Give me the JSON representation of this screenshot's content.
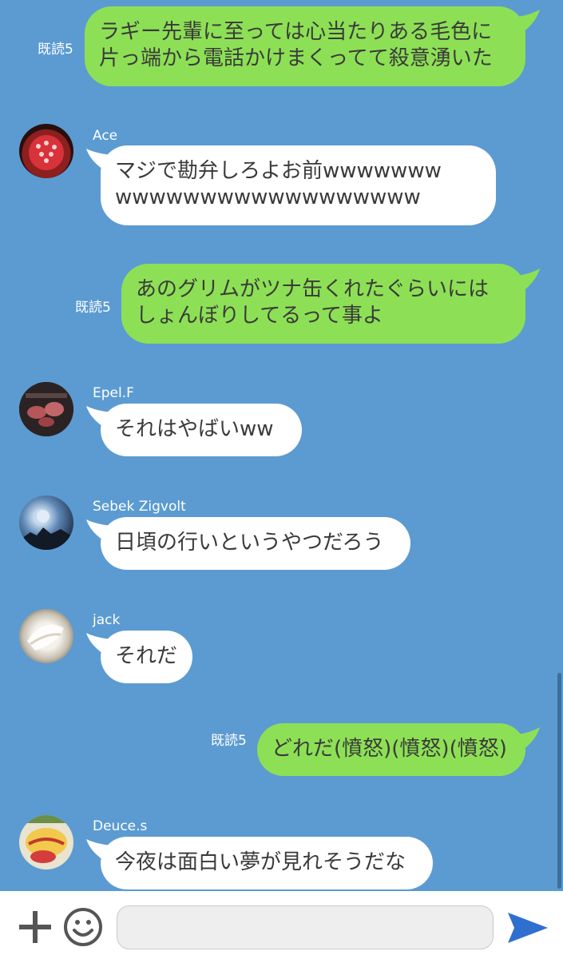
{
  "messages": [
    {
      "type": "sent",
      "read": "既読5",
      "lines": [
        "ラギー先輩に至っては心当たりある毛色に",
        "片っ端から電話かけまくってて殺意湧いた"
      ]
    },
    {
      "type": "recv",
      "name": "Ace",
      "lines": [
        "マジで勘弁しろよお前wwwwwww",
        "wwwwwwwwwwwwwwwwww"
      ]
    },
    {
      "type": "sent",
      "read": "既読5",
      "lines": [
        "あのグリムがツナ缶くれたぐらいには",
        "しょんぼりしてるって事よ"
      ]
    },
    {
      "type": "recv",
      "name": "Epel.F",
      "lines": [
        "それはやばいww"
      ]
    },
    {
      "type": "recv",
      "name": "Sebek Zigvolt",
      "lines": [
        "日頃の行いというやつだろう"
      ]
    },
    {
      "type": "recv",
      "name": "jack",
      "lines": [
        "それだ"
      ]
    },
    {
      "type": "sent",
      "read": "既読5",
      "lines": [
        "どれだ(憤怒)(憤怒)(憤怒)"
      ]
    },
    {
      "type": "recv",
      "name": "Deuce.s",
      "lines": [
        "今夜は面白い夢が見れそうだな"
      ]
    }
  ],
  "input": {
    "placeholder": "",
    "icons": [
      "plus-icon",
      "emoji-icon",
      "send-icon"
    ]
  },
  "colors": {
    "background": "#5b9bd1",
    "sent_bubble": "#8de055",
    "recv_bubble": "#ffffff",
    "send_icon": "#2f6fcf"
  }
}
